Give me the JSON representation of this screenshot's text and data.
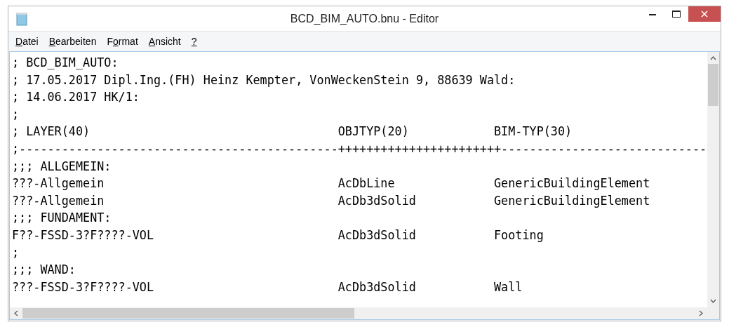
{
  "window": {
    "title": "BCD_BIM_AUTO.bnu - Editor"
  },
  "menu": [
    {
      "key": "D",
      "rest": "atei"
    },
    {
      "key": "B",
      "rest": "earbeiten"
    },
    {
      "before": "F",
      "key": "o",
      "rest": "rmat"
    },
    {
      "key": "A",
      "rest": "nsicht"
    },
    {
      "key": "?"
    }
  ],
  "editor": {
    "lines": [
      "; BCD_BIM_AUTO:",
      "; 17.05.2017 Dipl.Ing.(FH) Heinz Kempter, VonWeckenStein 9, 88639 Wald:",
      "; 14.06.2017 HK/1:",
      ";",
      "; LAYER(40)                                   OBJTYP(20)            BIM-TYP(30)",
      ";---------------------------------------------+++++++++++++++++++++++-----------------------------",
      ";;; ALLGEMEIN:",
      "???-Allgemein                                 AcDbLine              GenericBuildingElement",
      "???-Allgemein                                 AcDb3dSolid           GenericBuildingElement",
      ";;; FUNDAMENT:",
      "F??-FSSD-3?F????-VOL                          AcDb3dSolid           Footing",
      ";",
      ";;; WAND:",
      "???-FSSD-3?F????-VOL                          AcDb3dSolid           Wall"
    ]
  }
}
